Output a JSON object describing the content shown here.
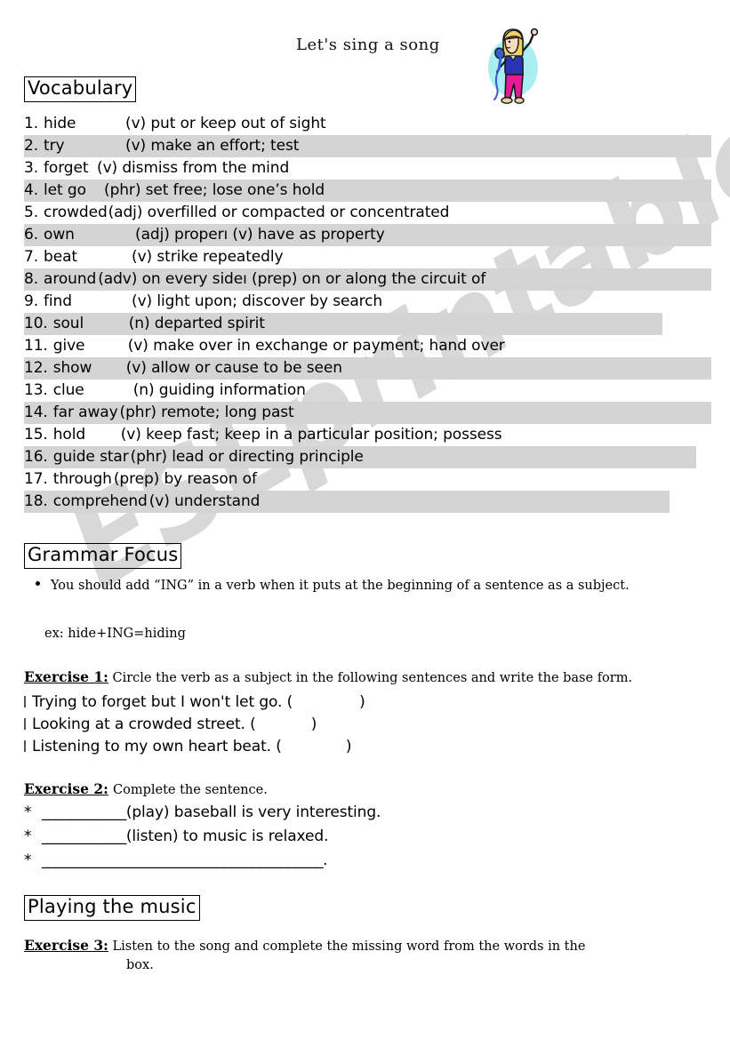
{
  "document": {
    "title": "Let's sing a song"
  },
  "clipart": {
    "name": "singer-clipart",
    "description": "cartoon girl singing into a microphone",
    "colors": {
      "backdrop": "#a9eef2",
      "hair": "#f2cf63",
      "skin": "#f7dcc0",
      "shirt": "#2b33b5",
      "pants": "#e31c96",
      "mic": "#3a5fcd",
      "outline": "#1a1a1a",
      "shoe": "#e8d49a"
    }
  },
  "sections": {
    "vocabulary": {
      "heading": "Vocabulary",
      "items": [
        {
          "num": "1.",
          "word": "hide",
          "pos": "(v)",
          "def": "put or keep out of sight",
          "highlight": false,
          "hl_width": 0,
          "word_pad": 64,
          "pos_pad": 38
        },
        {
          "num": "2.",
          "word": "try",
          "pos": "(v)",
          "def": "make an effort; test",
          "highlight": true,
          "hl_width": 773,
          "word_pad": 64,
          "pos_pad": 38
        },
        {
          "num": "3.",
          "word": "forget",
          "pos": "(v)",
          "def": "dismiss from the mind",
          "highlight": false,
          "hl_width": 0,
          "word_pad": 64,
          "pos_pad": 6
        },
        {
          "num": "4.",
          "word": "let go",
          "pos": "(phr)",
          "def": "set free; lose one’s hold",
          "highlight": true,
          "hl_width": 773,
          "word_pad": 64,
          "pos_pad": 14
        },
        {
          "num": "5.",
          "word": "crowded",
          "pos": "(adj)",
          "def": "overfilled or compacted or concentrated",
          "highlight": false,
          "hl_width": 0,
          "word_pad": 64,
          "pos_pad": 5
        },
        {
          "num": "6.",
          "word": "own",
          "pos": "(adj)",
          "def": "properı (v) have as property",
          "highlight": true,
          "hl_width": 773,
          "word_pad": 64,
          "pos_pad": 49
        },
        {
          "num": "7.",
          "word": "beat",
          "pos": "(v)",
          "def": "strike repeatedly",
          "highlight": false,
          "hl_width": 0,
          "word_pad": 64,
          "pos_pad": 45
        },
        {
          "num": "8.",
          "word": "around",
          "pos": "(adv)",
          "def": "on every sideı (prep) on or along the circuit of",
          "highlight": true,
          "hl_width": 773,
          "word_pad": 64,
          "pos_pad": 6
        },
        {
          "num": "9.",
          "word": "find",
          "pos": "(v)",
          "def": "light upon; discover by search",
          "highlight": false,
          "hl_width": 0,
          "word_pad": 64,
          "pos_pad": 45
        },
        {
          "num": "10.",
          "word": "soul",
          "pos": "(n)",
          "def": "departed spirit",
          "highlight": true,
          "hl_width": 718,
          "word_pad": 70,
          "pos_pad": 25
        },
        {
          "num": "11.",
          "word": "give",
          "pos": "(v)",
          "def": "make over in exchange or payment; hand over",
          "highlight": false,
          "hl_width": 0,
          "word_pad": 70,
          "pos_pad": 24
        },
        {
          "num": "12.",
          "word": "show",
          "pos": "(v)",
          "def": "allow or cause to be seen",
          "highlight": true,
          "hl_width": 773,
          "word_pad": 70,
          "pos_pad": 22
        },
        {
          "num": "13.",
          "word": "clue",
          "pos": "(n)",
          "def": "guiding information",
          "highlight": false,
          "hl_width": 0,
          "word_pad": 70,
          "pos_pad": 30
        },
        {
          "num": "14.",
          "word": "far away",
          "pos": "(phr)",
          "def": "remote; long past",
          "highlight": true,
          "hl_width": 773,
          "word_pad": 70,
          "pos_pad": 6
        },
        {
          "num": "15.",
          "word": "hold",
          "pos": "(v)",
          "def": "keep fast; keep in a particular position; possess",
          "highlight": false,
          "hl_width": 0,
          "word_pad": 70,
          "pos_pad": 16
        },
        {
          "num": "16.",
          "word": "guide star",
          "pos": "(phr)",
          "def": "lead or directing principle",
          "highlight": true,
          "hl_width": 756,
          "word_pad": 70,
          "pos_pad": 6
        },
        {
          "num": "17.",
          "word": "through",
          "pos": "(prep)",
          "def": "by reason of",
          "highlight": false,
          "hl_width": 0,
          "word_pad": 70,
          "pos_pad": 6
        },
        {
          "num": "18.",
          "word": "comprehend",
          "pos": "(v)",
          "def": "understand",
          "highlight": true,
          "hl_width": 726,
          "word_pad": 70,
          "pos_pad": 6
        }
      ]
    },
    "grammar": {
      "heading": "Grammar Focus",
      "bullet": "You should add “ING” in a verb when it puts at the beginning of a sentence as a subject.",
      "example": "ex: hide+ING=hiding"
    },
    "exercise1": {
      "label": "Exercise 1:",
      "instruction": "Circle the verb as a subject in the following sentences and write the base form.",
      "items": [
        {
          "text": "Trying to forget but I won't let go. (",
          "gap": 75,
          "close": ")"
        },
        {
          "text": "Looking at a crowded street. (",
          "gap": 62,
          "close": ")"
        },
        {
          "text": "Listening to my own heart beat. (",
          "gap": 72,
          "close": ")"
        }
      ]
    },
    "exercise2": {
      "label": "Exercise 2:",
      "instruction": "Complete the sentence.",
      "items": [
        {
          "star": "*",
          "blank": "____________",
          "text": "(play) baseball is very interesting."
        },
        {
          "star": "*",
          "blank": "____________",
          "text": "(listen) to music is relaxed."
        },
        {
          "star": "*",
          "blank": "________________________________________",
          "text": "."
        }
      ]
    },
    "playing": {
      "heading": "Playing the music"
    },
    "exercise3": {
      "label": "Exercise 3:",
      "instruction": "Listen to the song and complete the missing word from the words in the",
      "instruction_line2": "box."
    }
  },
  "watermark": {
    "text": "ESLprintables.com"
  }
}
